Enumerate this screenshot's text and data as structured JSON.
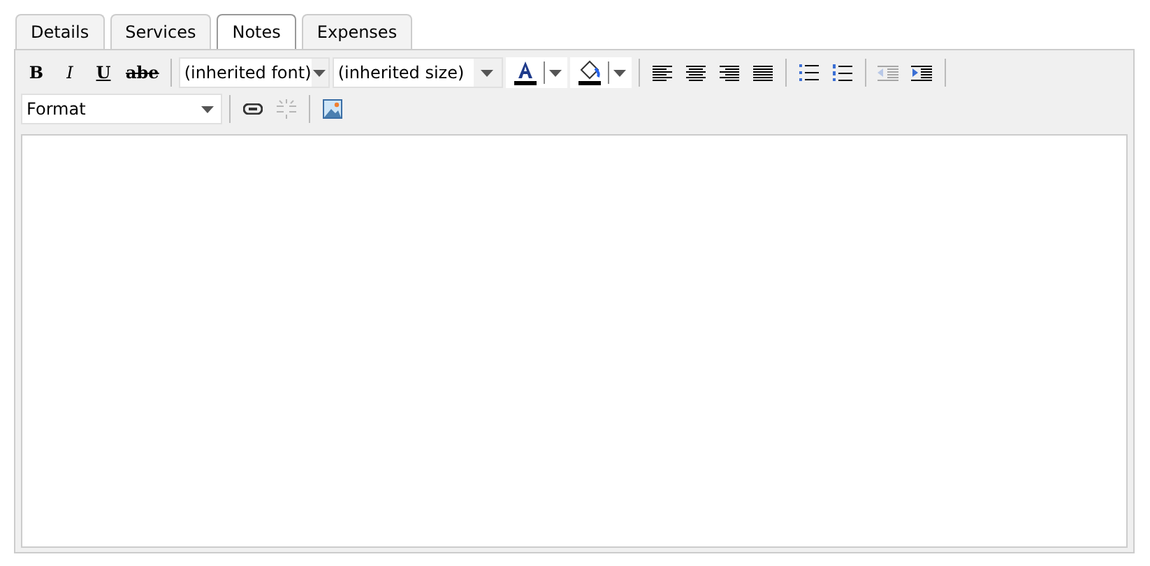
{
  "tabs": [
    {
      "label": "Details",
      "selected": false
    },
    {
      "label": "Services",
      "selected": false
    },
    {
      "label": "Notes",
      "selected": true
    },
    {
      "label": "Expenses",
      "selected": false
    }
  ],
  "toolbar": {
    "text_styles": [
      {
        "label": "B",
        "kind": "bold"
      },
      {
        "label": "I",
        "kind": "italic"
      },
      {
        "label": "U",
        "kind": "underline"
      },
      {
        "label": "abe",
        "kind": "strike"
      }
    ],
    "font": {
      "value": "(inherited font)"
    },
    "size": {
      "value": "(inherited size)"
    },
    "format": {
      "value": "Format"
    },
    "buttons": [
      {
        "kind": "link",
        "disabled": false
      },
      {
        "kind": "unlink",
        "disabled": true
      },
      {
        "kind": "image",
        "disabled": false
      }
    ],
    "indent_buttons": [
      {
        "kind": "outdent",
        "disabled": true
      },
      {
        "kind": "indent",
        "disabled": false
      }
    ]
  }
}
